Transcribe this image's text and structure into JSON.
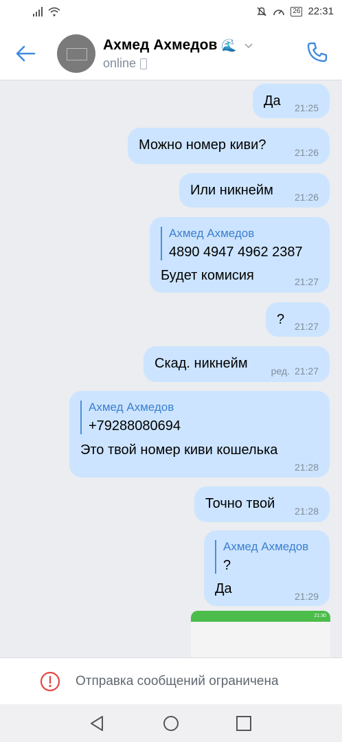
{
  "status_bar": {
    "time": "22:31",
    "battery": "26"
  },
  "header": {
    "contact_name": "Ахмед Ахмедов",
    "name_emoji": "🌊",
    "status": "online"
  },
  "messages": [
    {
      "text": "Да",
      "time": "21:25"
    },
    {
      "text": "Можно номер киви?",
      "time": "21:26"
    },
    {
      "text": "Или никнейм",
      "time": "21:26"
    },
    {
      "quote_author": "Ахмед Ахмедов",
      "quote_text": "4890 4947 4962 2387",
      "text": "Будет комисия",
      "time": "21:27"
    },
    {
      "text": "?",
      "time": "21:27"
    },
    {
      "text": "Скад. никнейм",
      "edited_label": "ред.",
      "time": "21:27"
    },
    {
      "quote_author": "Ахмед Ахмедов",
      "quote_text": "+79288080694",
      "text": "Это твой номер киви кошелька",
      "time": "21:28"
    },
    {
      "text": "Точно твой",
      "time": "21:28"
    },
    {
      "quote_author": "Ахмед Ахмедов",
      "quote_text": "?",
      "text": "Да",
      "time": "21:29"
    }
  ],
  "thumbnail": {
    "status_time": "21:30"
  },
  "restricted_banner": {
    "text": "Отправка сообщений ограничена"
  },
  "colors": {
    "accent": "#3f8ae0",
    "bubble": "#cce4ff",
    "warning": "#e64646"
  }
}
